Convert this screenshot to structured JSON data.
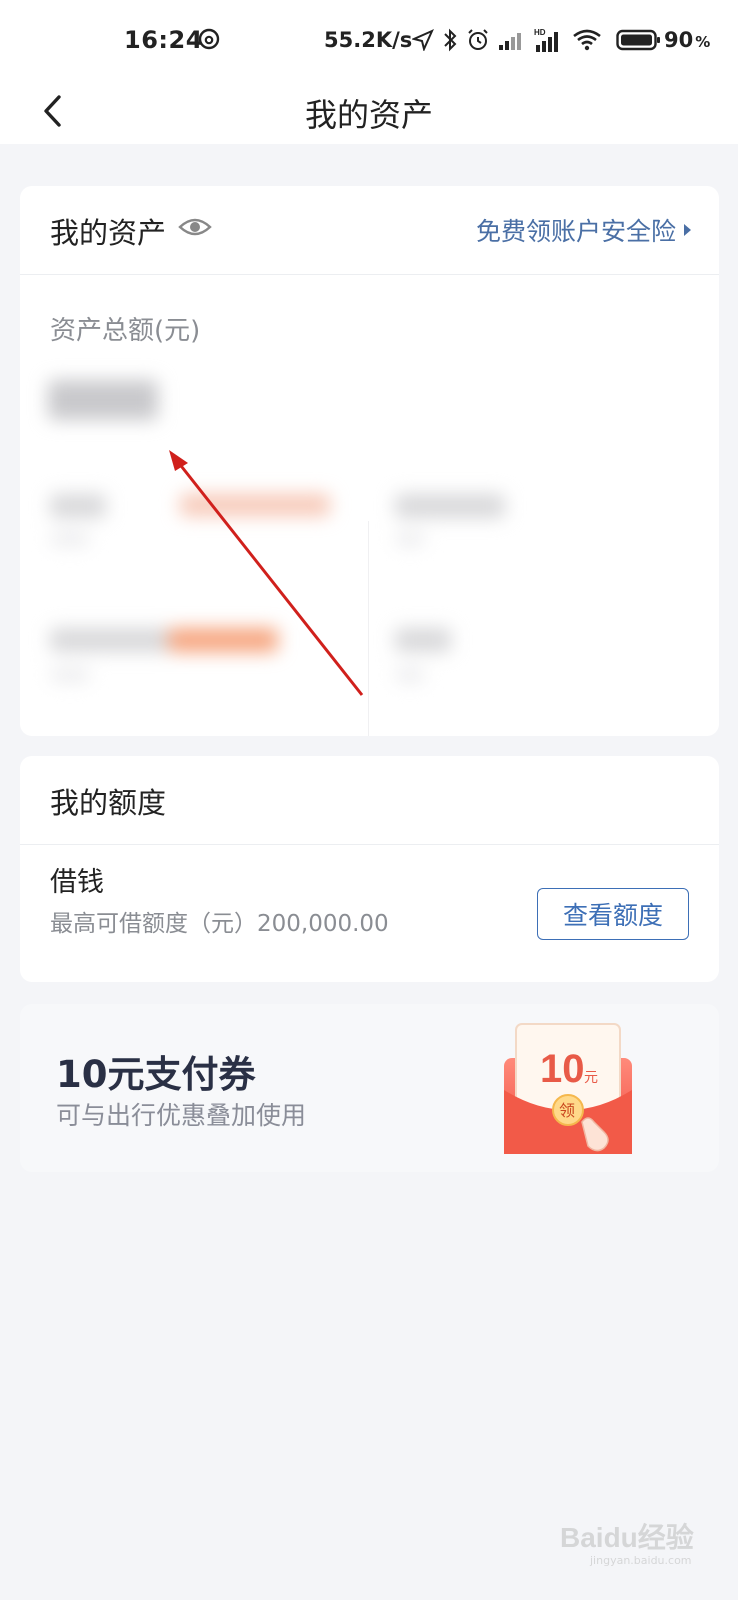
{
  "status_bar": {
    "time": "16:24",
    "net_speed": "55.2K/s",
    "battery_percent": "90",
    "battery_unit": "%",
    "icons": [
      "netease-music-icon",
      "location-icon",
      "bluetooth-icon",
      "alarm-icon",
      "signal-icon",
      "hd-signal-icon",
      "wifi-icon",
      "battery-icon"
    ]
  },
  "nav": {
    "title": "我的资产",
    "back_icon": "chevron-left-icon"
  },
  "assets_card": {
    "title": "我的资产",
    "eye_icon": "eye-icon",
    "insurance_link": "免费领账户安全险",
    "total_label": "资产总额(元)"
  },
  "quota_card": {
    "title": "我的额度",
    "item_title": "借钱",
    "item_sub": "最高可借额度（元）200,000.00",
    "button_label": "查看额度"
  },
  "promo_card": {
    "title": "10元支付券",
    "subtitle": "可与出行优惠叠加使用",
    "packet_amount": "10",
    "packet_unit": "元",
    "packet_badge": "领"
  },
  "watermark": {
    "text": "Baidu经验",
    "subtext": "jingyan.baidu.com"
  },
  "colors": {
    "accent_blue": "#3d6fb6",
    "link_blue": "#4a6fa5",
    "annotation_red": "#d0201c",
    "background": "#f4f5f8"
  }
}
